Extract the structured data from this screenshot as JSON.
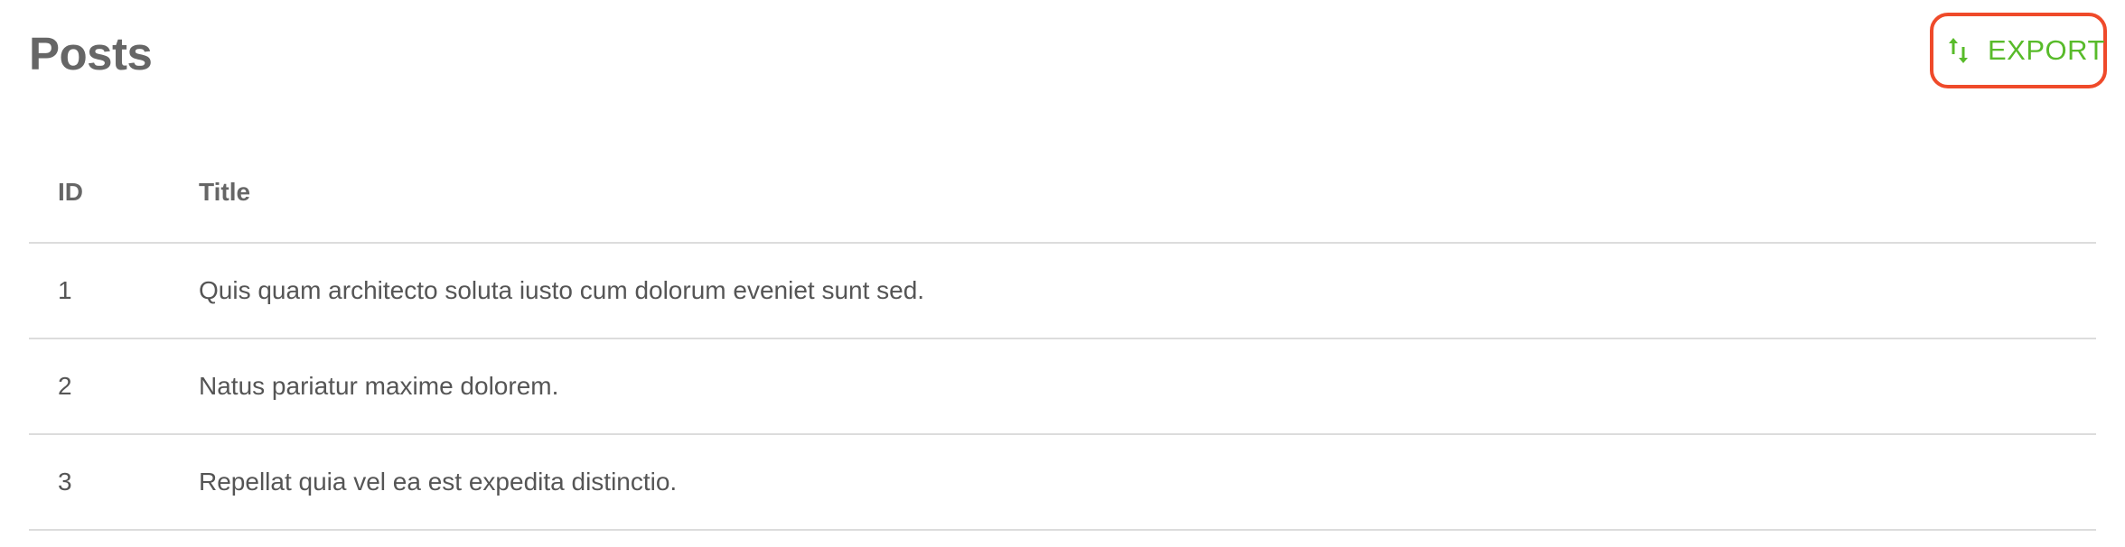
{
  "header": {
    "title": "Posts",
    "export_label": "EXPORT",
    "export_icon": "sort-arrows-icon"
  },
  "table": {
    "columns": {
      "id": "ID",
      "title": "Title"
    },
    "rows": [
      {
        "id": "1",
        "title": "Quis quam architecto soluta iusto cum dolorum eveniet sunt sed."
      },
      {
        "id": "2",
        "title": "Natus pariatur maxime dolorem."
      },
      {
        "id": "3",
        "title": "Repellat quia vel ea est expedita distinctio."
      }
    ]
  },
  "colors": {
    "accent": "#58bb2a",
    "highlight_border": "#ef4a2a",
    "text": "#555555",
    "divider": "#dcdcdc"
  }
}
